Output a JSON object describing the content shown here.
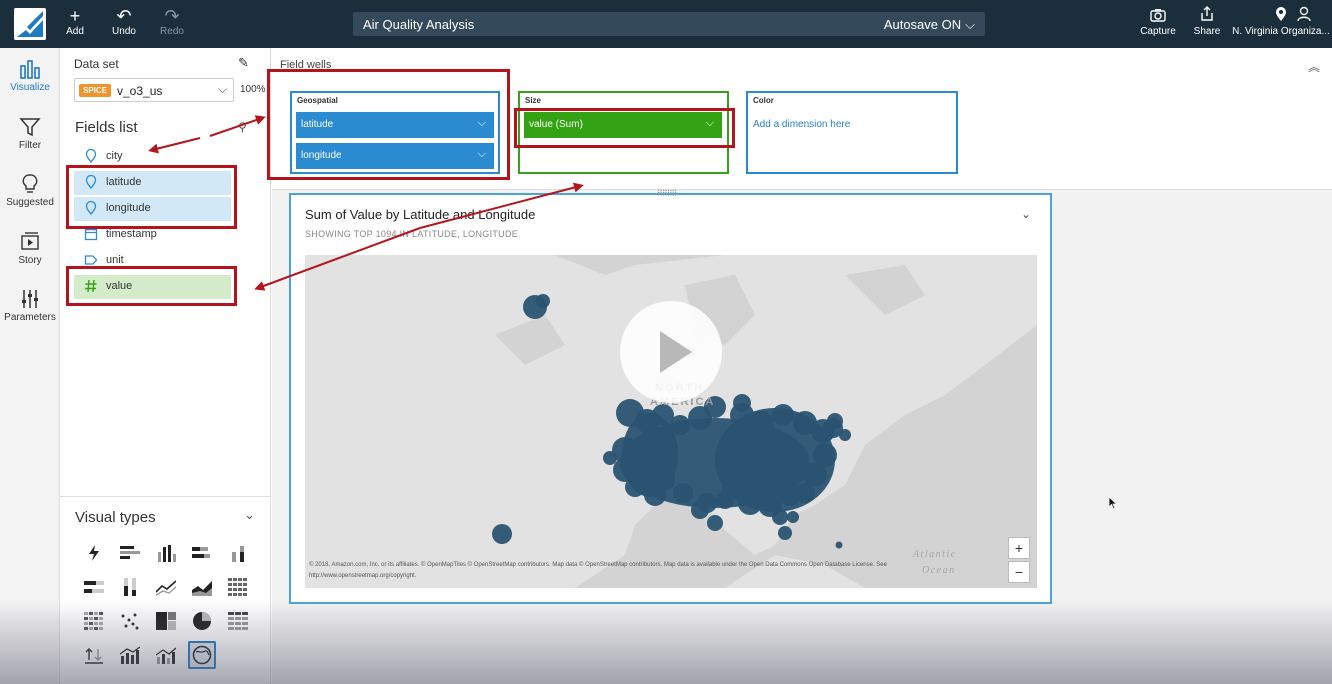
{
  "topbar": {
    "add_label": "Add",
    "undo_label": "Undo",
    "redo_label": "Redo",
    "analysis_title": "Air Quality Analysis",
    "autosave_label": "Autosave ON",
    "capture_label": "Capture",
    "share_label": "Share",
    "region_label": "N. Virginia Organiza..."
  },
  "rail": {
    "items": [
      {
        "label": "Visualize",
        "icon": "bar-chart-icon"
      },
      {
        "label": "Filter",
        "icon": "funnel-icon"
      },
      {
        "label": "Suggested",
        "icon": "lightbulb-icon"
      },
      {
        "label": "Story",
        "icon": "story-icon"
      },
      {
        "label": "Parameters",
        "icon": "sliders-icon"
      }
    ]
  },
  "panel": {
    "dataset_label": "Data set",
    "spice_badge": "SPICE",
    "dataset_name": "v_o3_us",
    "dataset_pct": "100%",
    "fields_title": "Fields list",
    "fields": [
      {
        "name": "city",
        "icon": "geo-pin-icon"
      },
      {
        "name": "latitude",
        "icon": "geo-pin-icon"
      },
      {
        "name": "longitude",
        "icon": "geo-pin-icon"
      },
      {
        "name": "timestamp",
        "icon": "calendar-icon"
      },
      {
        "name": "unit",
        "icon": "tag-icon"
      },
      {
        "name": "value",
        "icon": "hash-icon"
      }
    ],
    "visual_types_title": "Visual types"
  },
  "wells": {
    "title": "Field wells",
    "geospatial_label": "Geospatial",
    "geo_fields": [
      "latitude",
      "longitude"
    ],
    "size_label": "Size",
    "size_field": "value (Sum)",
    "color_label": "Color",
    "color_placeholder": "Add a dimension here"
  },
  "visual": {
    "title": "Sum of Value by Latitude and Longitude",
    "subtitle": "SHOWING TOP 1094 IN LATITUDE, LONGITUDE",
    "map_label_continent": "NORTH AMERICA",
    "map_label_ocean": "Atlantic Ocean",
    "attribution": "© 2018, Amazon.com, Inc. or its affiliates. © OpenMapTiles © OpenStreetMap contributors. Map data © OpenStreetMap contributors. Map data is available under the Open Data Commons Open Database License. See",
    "attribution_url": "http://www.openstreetmap.org/copyright.",
    "zoom_in": "+",
    "zoom_out": "−"
  },
  "colors": {
    "topbar": "#1b2e3c",
    "accent_blue": "#2b8bd1",
    "accent_green": "#33a313",
    "annotation_red": "#b4141c",
    "bubble": "#2a5371"
  }
}
